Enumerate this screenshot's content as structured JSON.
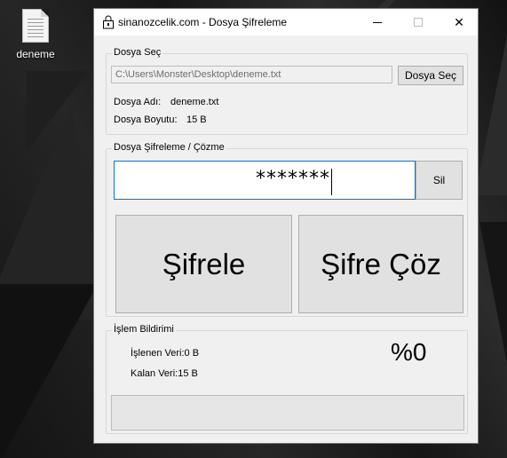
{
  "desktop": {
    "icon_label": "deneme"
  },
  "window": {
    "title": "sinanozcelik.com - Dosya Şifreleme",
    "minimize_glyph": "",
    "close_glyph": "✕"
  },
  "file_group": {
    "legend": "Dosya Seç",
    "path_value": "C:\\Users\\Monster\\Desktop\\deneme.txt",
    "select_button": "Dosya Seç",
    "name_label": "Dosya Adı:",
    "name_value": "deneme.txt",
    "size_label": "Dosya Boyutu:",
    "size_value": "15 B"
  },
  "crypto_group": {
    "legend": "Dosya Şifreleme / Çözme",
    "password_value": "*******",
    "clear_button": "Sil",
    "encrypt_button": "Şifrele",
    "decrypt_button": "Şifre Çöz"
  },
  "status_group": {
    "legend": "İşlem Bildirimi",
    "processed_label": "İşlenen Veri:0 B",
    "remaining_label": "Kalan Veri:15 B",
    "percent": "%0",
    "progress_fraction": 0
  },
  "colors": {
    "accent_border": "#0078d7",
    "progress_fill": "#06b025"
  }
}
